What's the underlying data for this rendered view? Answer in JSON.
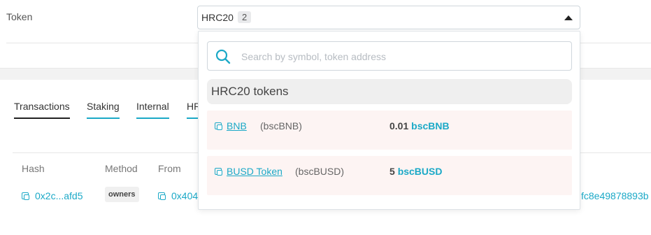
{
  "token_field": {
    "label": "Token",
    "selected_value": "HRC20",
    "selected_count": "2"
  },
  "tabs": [
    {
      "label": "Transactions",
      "active": true
    },
    {
      "label": "Staking",
      "active": false
    },
    {
      "label": "Internal",
      "active": false
    },
    {
      "label": "HR",
      "active": false
    }
  ],
  "table": {
    "headers": [
      "Hash",
      "Method",
      "From"
    ],
    "row": {
      "hash": "0x2c...afd5",
      "method": "owners",
      "from": "0x404",
      "to_tail": "fc8e49878893b"
    }
  },
  "dropdown": {
    "search_placeholder": "Search by symbol, token address",
    "group_title": "HRC20 tokens",
    "tokens": [
      {
        "name": "BNB",
        "symbol": "(bscBNB)",
        "amount": "0.01",
        "amount_symbol": "bscBNB"
      },
      {
        "name": "BUSD Token",
        "symbol": "(bscBUSD)",
        "amount": "5",
        "amount_symbol": "bscBUSD"
      }
    ]
  },
  "colors": {
    "accent": "#1ba9c7",
    "row_background": "#fdf4f3",
    "group_background": "#efefef"
  }
}
